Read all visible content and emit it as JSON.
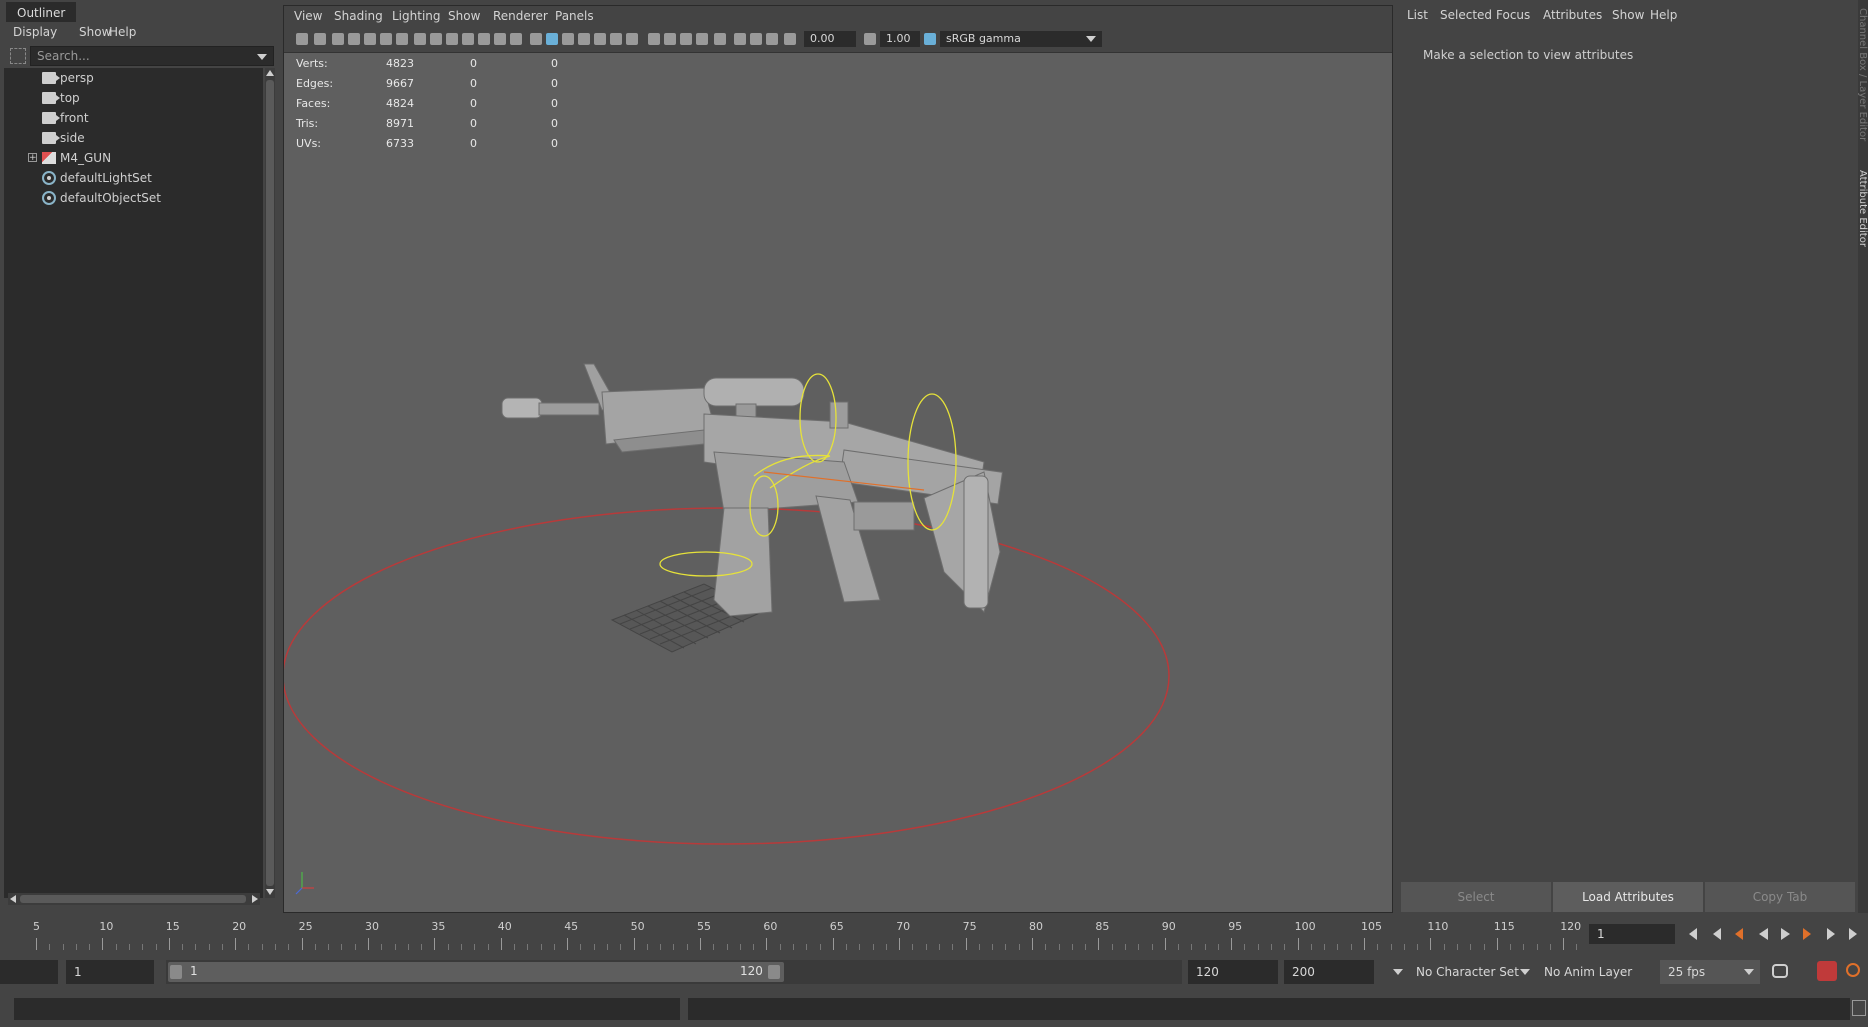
{
  "outliner": {
    "tab_title": "Outliner",
    "menu": [
      "Display",
      "Show",
      "Help"
    ],
    "search_placeholder": "Search...",
    "items": [
      {
        "label": "persp",
        "icon": "camera-icon"
      },
      {
        "label": "top",
        "icon": "camera-icon"
      },
      {
        "label": "front",
        "icon": "camera-icon"
      },
      {
        "label": "side",
        "icon": "camera-icon"
      },
      {
        "label": "M4_GUN",
        "icon": "mesh-group-icon",
        "expand": "+"
      },
      {
        "label": "defaultLightSet",
        "icon": "set-icon"
      },
      {
        "label": "defaultObjectSet",
        "icon": "set-icon"
      }
    ]
  },
  "viewport": {
    "menu": [
      "View",
      "Shading",
      "Lighting",
      "Show",
      "Renderer",
      "Panels"
    ],
    "exposure": "0.00",
    "gamma": "1.00",
    "color_space": "sRGB gamma",
    "hud": [
      {
        "label": "Verts:",
        "values": [
          "4823",
          "0",
          "0"
        ]
      },
      {
        "label": "Edges:",
        "values": [
          "9667",
          "0",
          "0"
        ]
      },
      {
        "label": "Faces:",
        "values": [
          "4824",
          "0",
          "0"
        ]
      },
      {
        "label": "Tris:",
        "values": [
          "8971",
          "0",
          "0"
        ]
      },
      {
        "label": "UVs:",
        "values": [
          "6733",
          "0",
          "0"
        ]
      }
    ]
  },
  "attribute_editor": {
    "menu": [
      "List",
      "Selected",
      "Focus",
      "Attributes",
      "Show",
      "Help"
    ],
    "message": "Make a selection to view attributes",
    "buttons": {
      "select": "Select",
      "load": "Load Attributes",
      "copy": "Copy Tab"
    },
    "side_tabs": [
      "Channel Box / Layer Editor",
      "Attribute Editor"
    ]
  },
  "timeline": {
    "labels": [
      "5",
      "10",
      "15",
      "20",
      "25",
      "30",
      "35",
      "40",
      "45",
      "50",
      "55",
      "60",
      "65",
      "70",
      "75",
      "80",
      "85",
      "90",
      "95",
      "100",
      "105",
      "110",
      "115",
      "120"
    ],
    "current_frame": "1"
  },
  "range": {
    "start_time": "",
    "start_frame": "1",
    "slider_start": "1",
    "slider_end": "120",
    "end_frame": "120",
    "end_time": "200",
    "character_set": "No Character Set",
    "anim_layer": "No Anim Layer",
    "fps": "25 fps"
  },
  "colors": {
    "background": "#444444",
    "viewport": "#5f5f5f",
    "panel_dark": "#2b2b2b",
    "accent_blue": "#6ab0d8",
    "manipulator_yellow": "#e6e23a",
    "ground_circle_red": "#b83a3a",
    "current_key_orange": "#e0702a"
  }
}
